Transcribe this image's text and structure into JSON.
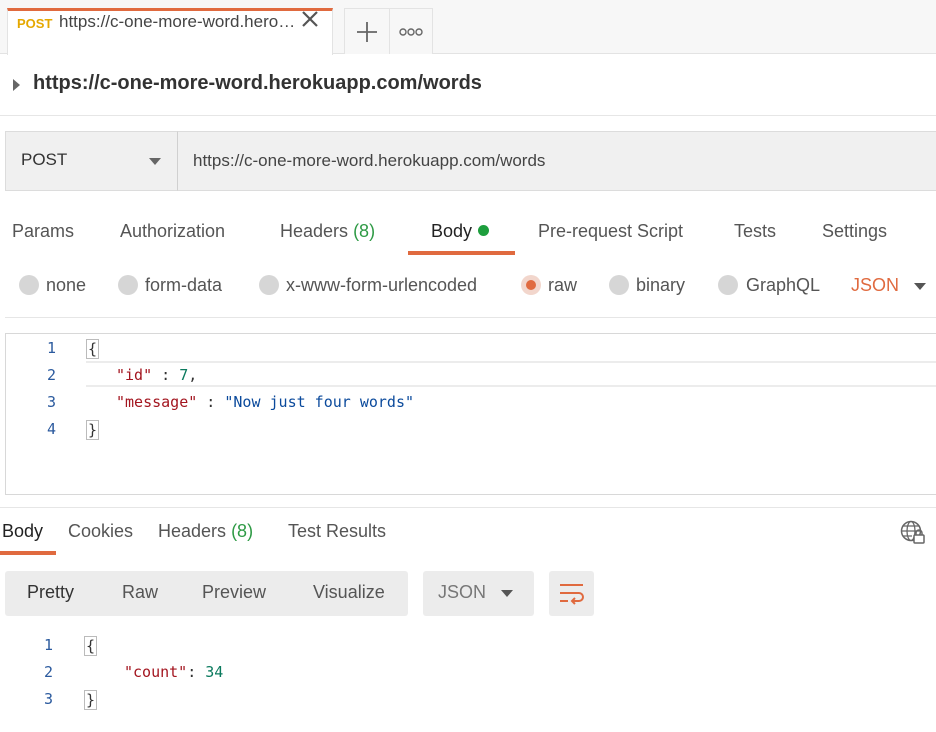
{
  "tab": {
    "method": "POST",
    "title": "https://c-one-more-word.herokuapp.com/words",
    "close_icon": "close-icon",
    "add_icon": "plus-icon",
    "more_icon": "more-horizontal-icon"
  },
  "request": {
    "title": "https://c-one-more-word.herokuapp.com/words",
    "method": "POST",
    "url": "https://c-one-more-word.herokuapp.com/words"
  },
  "request_tabs": {
    "params": "Params",
    "authorization": "Authorization",
    "headers": "Headers",
    "headers_count": "(8)",
    "body": "Body",
    "prerequest": "Pre-request Script",
    "tests": "Tests",
    "settings": "Settings"
  },
  "body_types": {
    "none": "none",
    "form_data": "form-data",
    "urlencoded": "x-www-form-urlencoded",
    "raw": "raw",
    "binary": "binary",
    "graphql": "GraphQL",
    "format": "JSON",
    "selected": "raw"
  },
  "request_body": {
    "line_numbers": [
      "1",
      "2",
      "3",
      "4"
    ],
    "open_brace": "{",
    "id_key": "\"id\"",
    "id_sep": " : ",
    "id_value": "7",
    "id_comma": ",",
    "message_key": "\"message\"",
    "message_sep": " : ",
    "message_value": "\"Now just four words\"",
    "close_brace": "}"
  },
  "response_tabs": {
    "body": "Body",
    "cookies": "Cookies",
    "headers": "Headers",
    "headers_count": "(8)",
    "test_results": "Test Results",
    "globe_icon": "globe-lock-icon"
  },
  "response_view": {
    "pretty": "Pretty",
    "raw": "Raw",
    "preview": "Preview",
    "visualize": "Visualize",
    "format": "JSON",
    "wrap_icon": "wrap-lines-icon"
  },
  "response_body": {
    "line_numbers": [
      "1",
      "2",
      "3"
    ],
    "open_brace": "{",
    "count_key": "\"count\"",
    "count_sep": ": ",
    "count_value": "34",
    "close_brace": "}"
  },
  "colors": {
    "accent": "#e06a3f",
    "method_post": "#e5a800",
    "success_green": "#1d9e3d"
  }
}
